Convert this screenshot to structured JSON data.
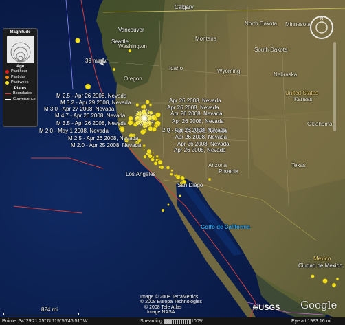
{
  "legend": {
    "title": "Magnitude",
    "age_title": "Age",
    "age_items": [
      {
        "label": "Past hour",
        "color": "#e02020"
      },
      {
        "label": "Past day",
        "color": "#f08a10"
      },
      {
        "label": "Past week",
        "color": "#f2e020"
      }
    ],
    "plates_title": "Plates",
    "plates_items": [
      {
        "label": "Boundaries",
        "color": "#d24040"
      },
      {
        "label": "Convergence",
        "color": "#ffffff"
      }
    ]
  },
  "places": {
    "calgary": "Calgary",
    "vancouver": "Vancouver",
    "seattle": "Seattle",
    "washington": "Washington",
    "montana": "Montana",
    "north_dakota": "North Dakota",
    "minnesota": "Minnesota",
    "south_dakota": "South Dakota",
    "idaho": "Idaho",
    "wyoming": "Wyoming",
    "oregon": "Oregon",
    "nebraska": "Nebraska",
    "united_states": "United States",
    "kansas": "Kansas",
    "oklahoma": "Oklahoma",
    "arizona": "Arizona",
    "phoenix": "Phoenix",
    "texas": "Texas",
    "los_angeles": "Los Angeles",
    "san_diego": "San Diego",
    "gulf": "Golfo de California",
    "mexico": "Mexico",
    "ciudad": "Ciudad de Mexico",
    "small_place": "39 mm/yr"
  },
  "quakes": [
    "M 2.5 - Apr 26 2008, Nevada",
    "M 3.2 - Apr 29 2008, Nevada",
    "M 3.0 - Apr 27 2008, Nevada",
    "M 4.7 - Apr 26 2008, Nevada",
    "M 3.5 - Apr 26 2008, Nevada",
    "M 2.0 - May 1 2008, Nevada",
    "M 2.5 - Apr 26 2008, Nevada",
    "M 2.0 - Apr 25 2008, Nevada",
    "Apr 26 2008, Nevada",
    "Apr 26 2008, Nevada",
    "Apr 26 2008, Nevada",
    "Apr 26 2008, Nevada",
    "3 - Apr 26 2008, Nevada",
    "- Apr 26 2008, Nevada",
    "Apr 26 2008, Nevada",
    "Apr 26 2008, Nevada",
    "2.0 - Apr 26 2008, Nevada"
  ],
  "credits": {
    "line1": "Image © 2008 TerraMetrics",
    "line2": "© 2008 Europa Technologies",
    "line3": "© 2008 Tele Atlas",
    "line4": "Image NASA"
  },
  "logos": {
    "usgs": "USGS",
    "google": "Google"
  },
  "scale": "824 mi",
  "coords": "Pointer 34°29'21.25\" N 119°56'46.51\" W",
  "streaming_label": "Streaming",
  "streaming_value": "100%",
  "eye_alt": "Eye alt 1983.16 mi",
  "colors": {
    "ocean": "#0b1d4a",
    "land": "#6b6438",
    "quake": "#f2e020",
    "plate": "#d24040"
  }
}
